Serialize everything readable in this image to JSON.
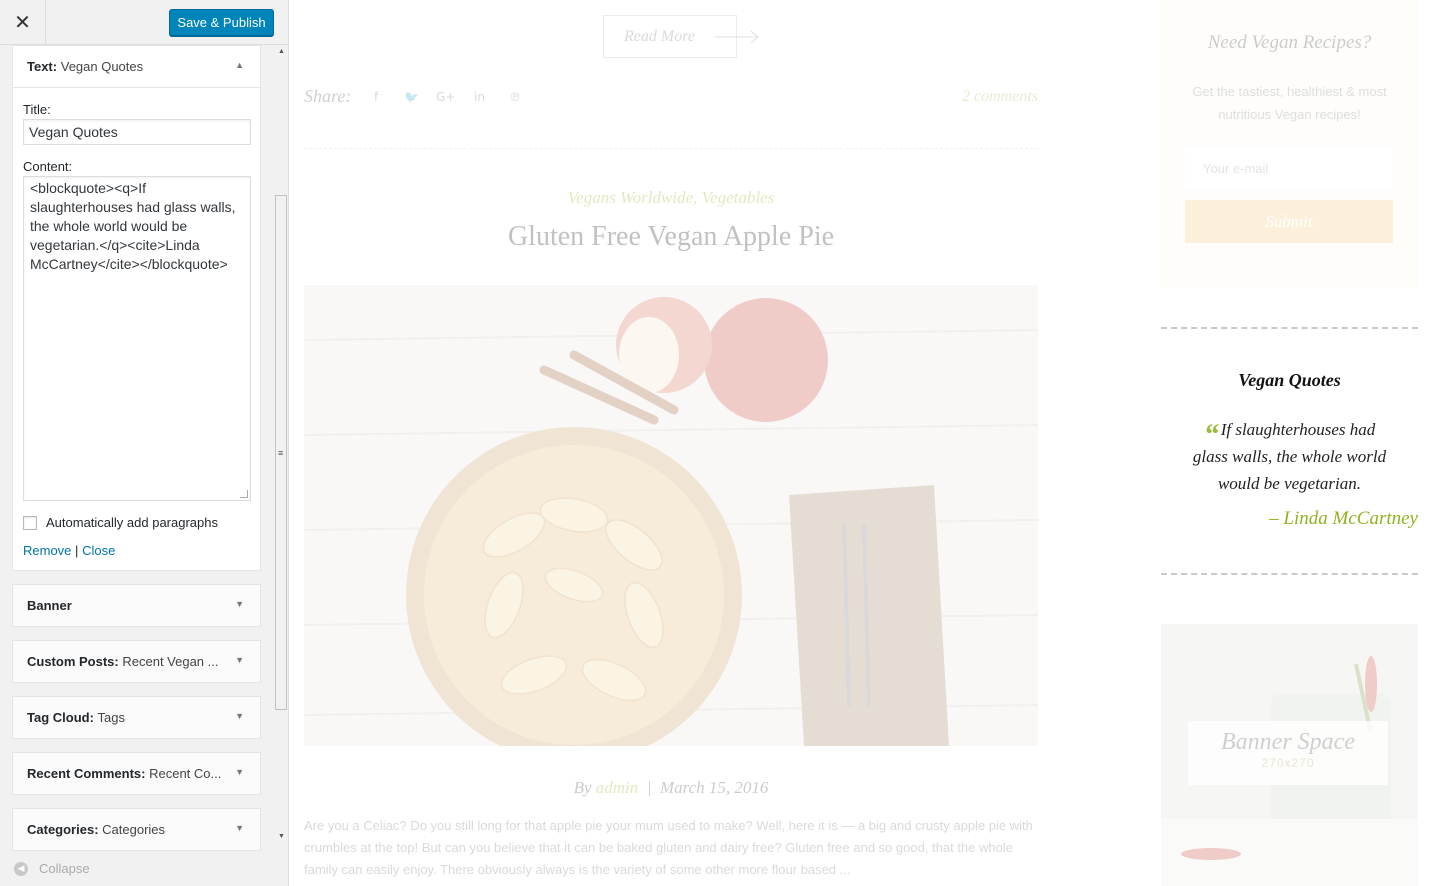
{
  "customizer": {
    "close_glyph": "✕",
    "save_label": "Save & Publish",
    "open_widget": {
      "type_label": "Text:",
      "title": "Vegan Quotes",
      "title_field_label": "Title:",
      "title_value": "Vegan Quotes",
      "content_field_label": "Content:",
      "content_value": "<blockquote><q>If slaughterhouses had glass walls, the whole world would be vegetarian.</q><cite>Linda McCartney</cite></blockquote>",
      "auto_paragraphs_label": "Automatically add paragraphs",
      "auto_paragraphs_checked": false,
      "remove_label": "Remove",
      "divider": "|",
      "close_label": "Close"
    },
    "widgets": [
      {
        "type": "Banner",
        "sub": ""
      },
      {
        "type": "Custom Posts:",
        "sub": "Recent Vegan ..."
      },
      {
        "type": "Tag Cloud:",
        "sub": "Tags"
      },
      {
        "type": "Recent Comments:",
        "sub": "Recent Co..."
      },
      {
        "type": "Categories:",
        "sub": "Categories"
      }
    ],
    "collapse_label": "Collapse",
    "accent_color": "#0085ba"
  },
  "preview": {
    "read_more": "Read More",
    "share_label": "Share:",
    "social_icons": [
      "facebook-icon",
      "twitter-icon",
      "google-plus-icon",
      "linkedin-icon",
      "pinterest-icon"
    ],
    "social_glyphs": [
      "f",
      "🐦",
      "G+",
      "in",
      "℗"
    ],
    "comments_link": "2 comments",
    "post": {
      "categories": "Vegans Worldwide, Vegetables",
      "title": "Gluten Free Vegan Apple Pie",
      "by": "By",
      "author": "admin",
      "meta_sep": "|",
      "date": "March 15, 2016",
      "excerpt": "Are you a Celiac? Do you still long for that apple pie your mum used to make? Well, here it is — a big and crusty apple pie with crumbles at the top! But can you believe that it can be baked gluten and dairy free? Gluten free and so good, that the whole family can easily enjoy. There obviously always is the variety of some other more flour based ..."
    },
    "sidebar": {
      "newsletter_title": "Need Vegan Recipes?",
      "newsletter_desc": "Get the tastiest, healthiest & most nutritious Vegan recipes!",
      "email_placeholder": "Your e-mail",
      "submit_label": "Submit",
      "quotes_title": "Vegan Quotes",
      "quote_mark": "“",
      "quote_text": "If slaughterhouses had glass walls, the whole world would be vegetarian.",
      "quote_cite": "– Linda McCartney",
      "banner_title": "Banner Space",
      "banner_size": "270x270"
    }
  }
}
